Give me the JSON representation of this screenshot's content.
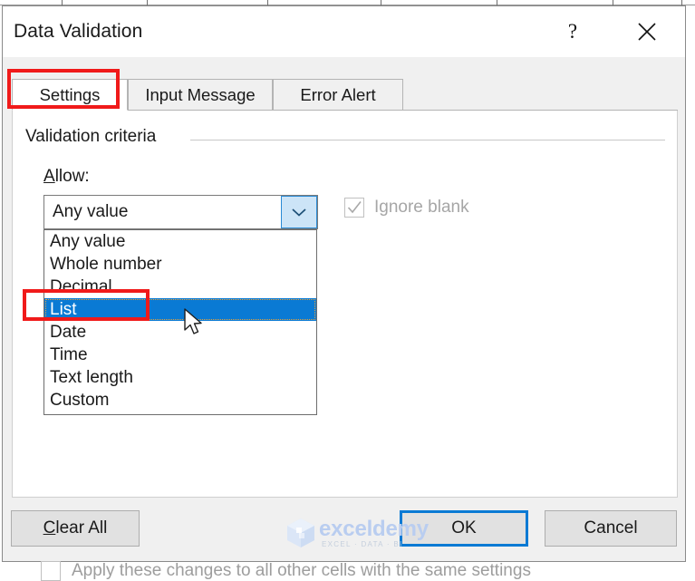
{
  "window": {
    "title": "Data Validation",
    "help_button": "?",
    "close_button": "✕"
  },
  "tabs": [
    {
      "label": "Settings",
      "selected": true
    },
    {
      "label": "Input Message",
      "selected": false
    },
    {
      "label": "Error Alert",
      "selected": false
    }
  ],
  "settings_panel": {
    "group_title": "Validation criteria",
    "allow": {
      "label_accel": "A",
      "label_rest": "llow:",
      "label_full": "Allow:",
      "selected_value": "Any value",
      "dropdown_open": true,
      "options": [
        "Any value",
        "Whole number",
        "Decimal",
        "List",
        "Date",
        "Time",
        "Text length",
        "Custom"
      ],
      "highlighted_option": "List"
    },
    "ignore_blank": {
      "label": "Ignore blank",
      "checked": true,
      "enabled": false
    },
    "apply_all": {
      "label": "Apply these changes to all other cells with the same settings",
      "checked": false,
      "enabled": false
    }
  },
  "footer": {
    "clear_all_accel": "C",
    "clear_all_rest": "lear All",
    "clear_all_label": "Clear All",
    "ok_label": "OK",
    "cancel_label": "Cancel",
    "default_button": "OK"
  },
  "watermark": {
    "brand": "exceldemy",
    "tagline": "EXCEL · DATA · BI"
  },
  "annotations": [
    {
      "target": "Settings",
      "shape": "rectangle",
      "color": "#f01a1a"
    },
    {
      "target": "List",
      "shape": "rectangle",
      "color": "#f01a1a"
    }
  ],
  "colors": {
    "accent_blue": "#0a7ad4",
    "annotation_red": "#f01a1a",
    "dialog_bg": "#f0f0f0",
    "panel_bg": "#ffffff",
    "disabled_text": "#a6a6a6",
    "combo_arrow_bg": "#cce4f7"
  }
}
